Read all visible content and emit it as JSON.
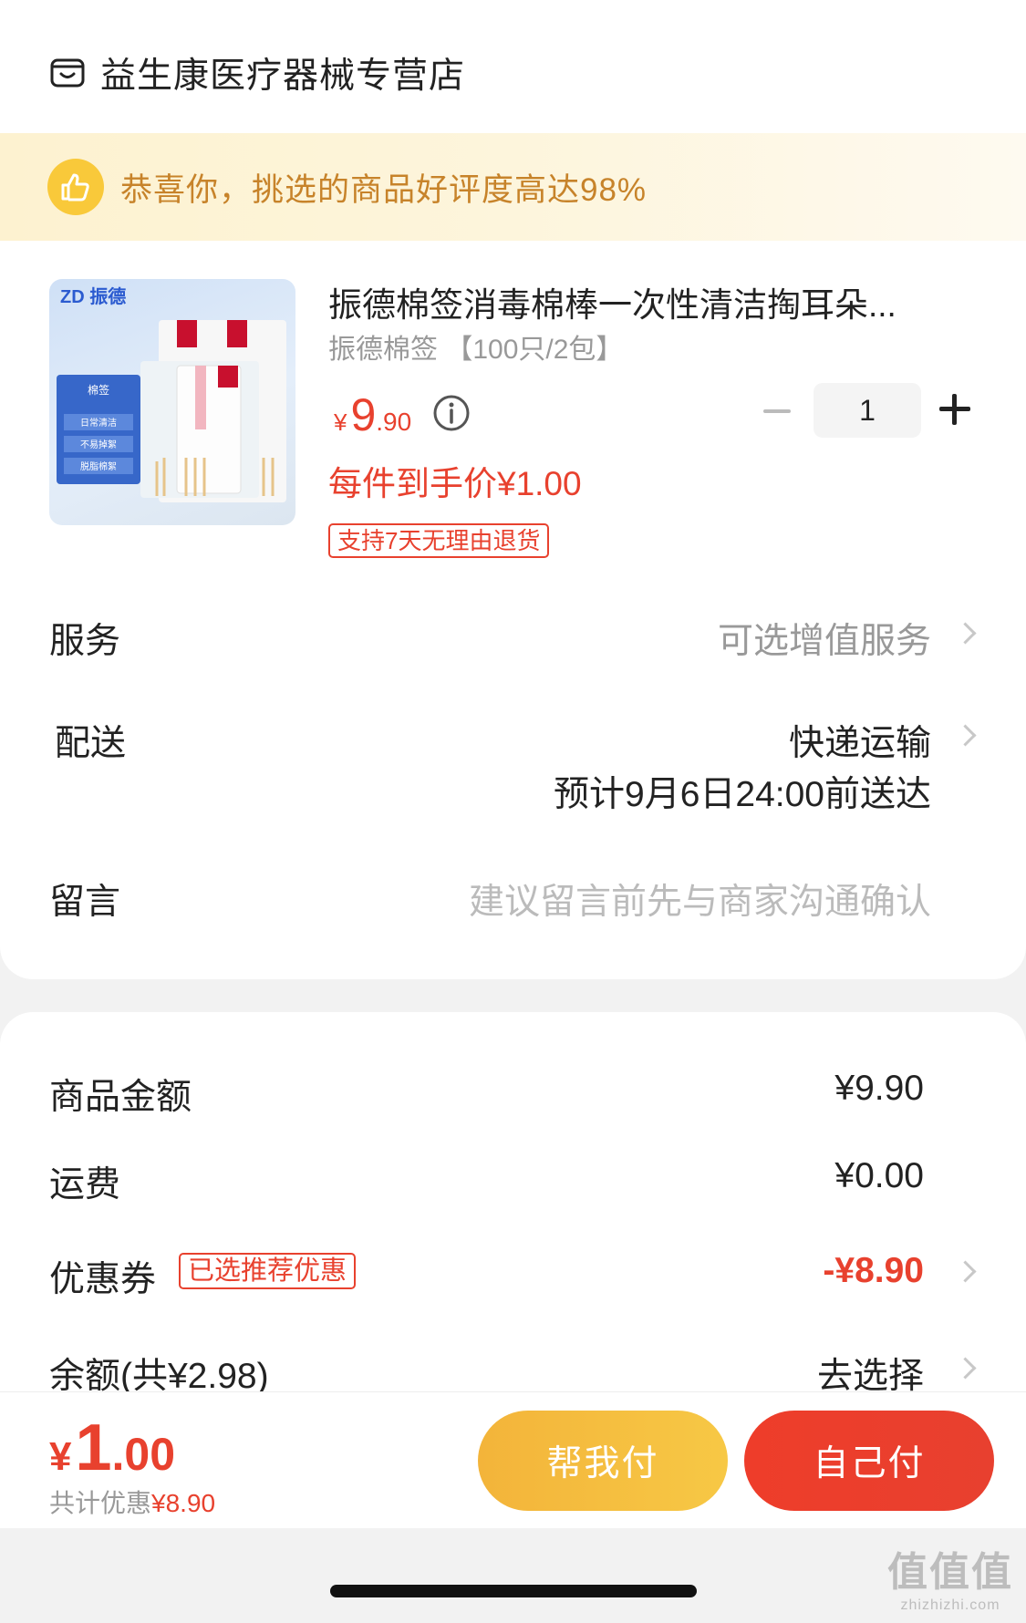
{
  "store": {
    "name": "益生康医疗器械专营店",
    "icon": "store-icon"
  },
  "praise": {
    "text": "恭喜你，挑选的商品好评度高达98%",
    "icon": "thumbs-up-icon"
  },
  "product": {
    "image_brand": "ZD 振德",
    "image_labels": [
      "棉签",
      "日常清洁",
      "不易掉絮",
      "脱脂棉絮"
    ],
    "title": "振德棉签消毒棉棒一次性清洁掏耳朵...",
    "spec": "振德棉签 【100只/2包】",
    "price_symbol": "¥",
    "price_int": "9",
    "price_dec": ".90",
    "deal_price": "每件到手价¥1.00",
    "return_tag": "支持7天无理由退货",
    "quantity": "1"
  },
  "rows": {
    "service_label": "服务",
    "service_value": "可选增值服务",
    "delivery_label": "配送",
    "delivery_value": "快递运输",
    "delivery_eta": "预计9月6日24:00前送达",
    "message_label": "留言",
    "message_placeholder": "建议留言前先与商家沟通确认"
  },
  "summary": {
    "goods_label": "商品金额",
    "goods_value": "¥9.90",
    "shipping_label": "运费",
    "shipping_value": "¥0.00",
    "coupon_label": "优惠券",
    "coupon_tag": "已选推荐优惠",
    "coupon_value": "-¥8.90",
    "balance_label": "余额(共¥2.98)",
    "balance_value": "去选择"
  },
  "footer": {
    "total_symbol": "¥",
    "total_int": "1",
    "total_dec": ".00",
    "discount_prefix": "共计优惠",
    "discount_amount": "¥8.90",
    "help_pay": "帮我付",
    "self_pay": "自己付"
  },
  "watermark": {
    "big": "值值值",
    "small": "zhizhizhi.com"
  },
  "colors": {
    "accent_red": "#e8412e",
    "praise_text": "#c7832a",
    "help_btn": "#f3b43a",
    "self_btn": "#ee3d2a"
  }
}
